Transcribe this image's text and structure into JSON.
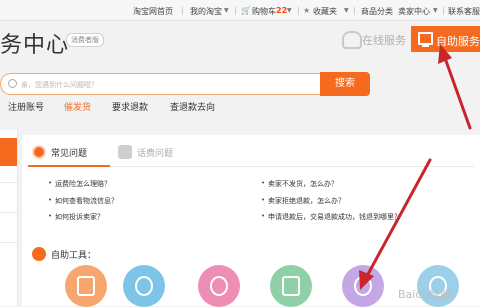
{
  "topbar": {
    "home": "淘宝网首页",
    "my_taobao": "我的淘宝",
    "cart_label": "购物车",
    "cart_count": "22",
    "favorites": "收藏夹",
    "categories": "商品分类",
    "seller_center": "卖家中心",
    "contact": "联系客服"
  },
  "header": {
    "logo_text": "务中心",
    "logo_badge": "消费者版",
    "online_service": "在线服务",
    "self_service": "自助服务"
  },
  "search": {
    "placeholder": "亲，您遇到什么问题啦？",
    "button": "搜索"
  },
  "nav": {
    "items": [
      "注册账号",
      "催发货",
      "要求退款",
      "查退款去向"
    ]
  },
  "tabs": {
    "faq": "常见问题",
    "phone": "话费问题"
  },
  "faq": {
    "left": [
      "运费险怎么理赔？",
      "如何查看物流信息？",
      "如何投诉卖家？"
    ],
    "right": [
      "卖家不发货，怎么办？",
      "卖家拒绝退款，怎么办？",
      "申请退款后，交易退款成功，钱退到哪里？"
    ]
  },
  "tools": {
    "label": "自助工具：",
    "icons": [
      "phone-recharge-icon",
      "exchange-icon",
      "user-icon",
      "document-icon",
      "check-icon",
      "history-icon"
    ]
  },
  "colors": {
    "accent": "#f56a1f",
    "annotation": "#c8262a"
  },
  "watermark": "Baidu经验"
}
